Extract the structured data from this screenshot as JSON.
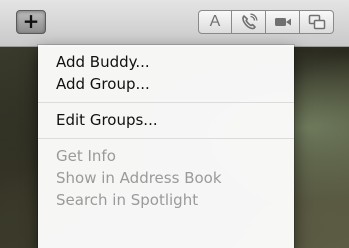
{
  "toolbar": {
    "add_icon": "plus-icon",
    "add_glyph": "+",
    "buttons": [
      {
        "name": "text-chat",
        "label": "A"
      },
      {
        "name": "audio-chat",
        "icon": "phone-icon"
      },
      {
        "name": "video-chat",
        "icon": "video-camera-icon"
      },
      {
        "name": "screen-sharing",
        "icon": "screen-share-icon"
      }
    ]
  },
  "menu": {
    "items": [
      {
        "label": "Add Buddy...",
        "enabled": true
      },
      {
        "label": "Add Group...",
        "enabled": true
      },
      {
        "label": "Edit Groups...",
        "enabled": true
      },
      {
        "label": "Get Info",
        "enabled": false
      },
      {
        "label": "Show in Address Book",
        "enabled": false
      },
      {
        "label": "Search in Spotlight",
        "enabled": false
      }
    ]
  },
  "colors": {
    "menu_text": "#111111",
    "menu_text_disabled": "#9a9a9a",
    "toolbar_bg": "#d6d6d6"
  }
}
